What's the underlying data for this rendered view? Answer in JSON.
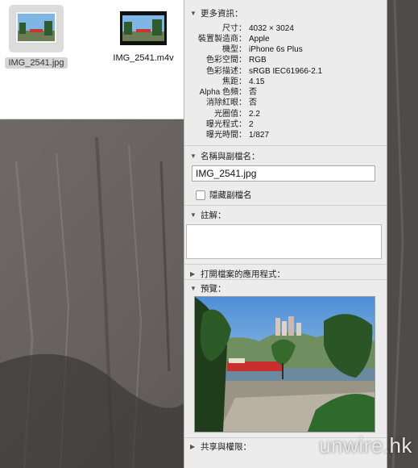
{
  "files": [
    {
      "name": "IMG_2541.jpg",
      "selected": true
    },
    {
      "name": "IMG_2541.m4v",
      "selected": false
    }
  ],
  "panel": {
    "more_info_header": "更多資訊：",
    "info_rows": [
      {
        "key": "尺寸：",
        "value": "4032 × 3024"
      },
      {
        "key": "裝置製造商：",
        "value": "Apple"
      },
      {
        "key": "機型：",
        "value": "iPhone 6s Plus"
      },
      {
        "key": "色彩空間：",
        "value": "RGB"
      },
      {
        "key": "色彩描述：",
        "value": "sRGB IEC61966-2.1"
      },
      {
        "key": "焦距：",
        "value": "4.15"
      },
      {
        "key": "Alpha 色頻：",
        "value": "否"
      },
      {
        "key": "消除紅眼：",
        "value": "否"
      },
      {
        "key": "光圈值：",
        "value": "2.2"
      },
      {
        "key": "曝光程式：",
        "value": "2"
      },
      {
        "key": "曝光時間：",
        "value": "1/827"
      }
    ],
    "name_ext_header": "名稱與副檔名：",
    "filename_value": "IMG_2541.jpg",
    "hide_ext_label": "隱藏副檔名",
    "comments_header": "註解：",
    "open_with_header": "打開檔案的應用程式：",
    "preview_header": "預覽：",
    "sharing_header": "共享與權限："
  },
  "watermark": "unwire.hk",
  "icons": {
    "expanded": "triangle-down",
    "collapsed": "triangle-right"
  }
}
